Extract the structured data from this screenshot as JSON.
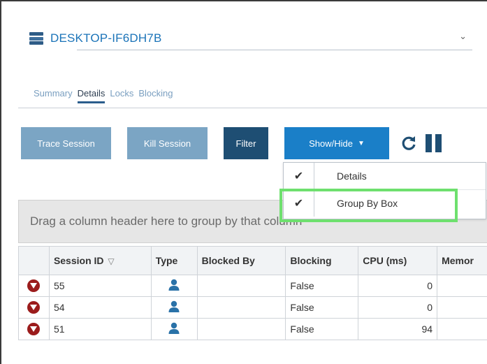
{
  "server": {
    "name": "DESKTOP-IF6DH7B",
    "chevron": "⌄",
    "icon": "server-icon"
  },
  "tabs": [
    {
      "label": "Summary",
      "active": false
    },
    {
      "label": "Details",
      "active": true
    },
    {
      "label": "Locks",
      "active": false
    },
    {
      "label": "Blocking",
      "active": false
    }
  ],
  "toolbar": {
    "trace_label": "Trace Session",
    "kill_label": "Kill Session",
    "filter_label": "Filter",
    "showhide_label": "Show/Hide",
    "caret": "▼"
  },
  "menu": {
    "items": [
      {
        "label": "Details",
        "checked": true,
        "check": "✔"
      },
      {
        "label": "Group By Box",
        "checked": true,
        "check": "✔"
      }
    ]
  },
  "group_area": {
    "text": "Drag a column header here to group by that column"
  },
  "grid": {
    "columns": [
      "Session ID",
      "Type",
      "Blocked By",
      "Blocking",
      "CPU (ms)",
      "Memor"
    ],
    "sort_icon": "▽",
    "rows": [
      {
        "session_id": "55",
        "type": "user",
        "blocked_by": "",
        "blocking": "False",
        "cpu": "0"
      },
      {
        "session_id": "54",
        "type": "user",
        "blocked_by": "",
        "blocking": "False",
        "cpu": "0"
      },
      {
        "session_id": "51",
        "type": "user",
        "blocked_by": "",
        "blocking": "False",
        "cpu": "94"
      }
    ]
  },
  "colors": {
    "accent": "#1a7fc8",
    "dark": "#1e4e73",
    "muted_button": "#7ba5c4",
    "highlight": "#6ee06e",
    "kill_icon": "#9b1c1c"
  }
}
